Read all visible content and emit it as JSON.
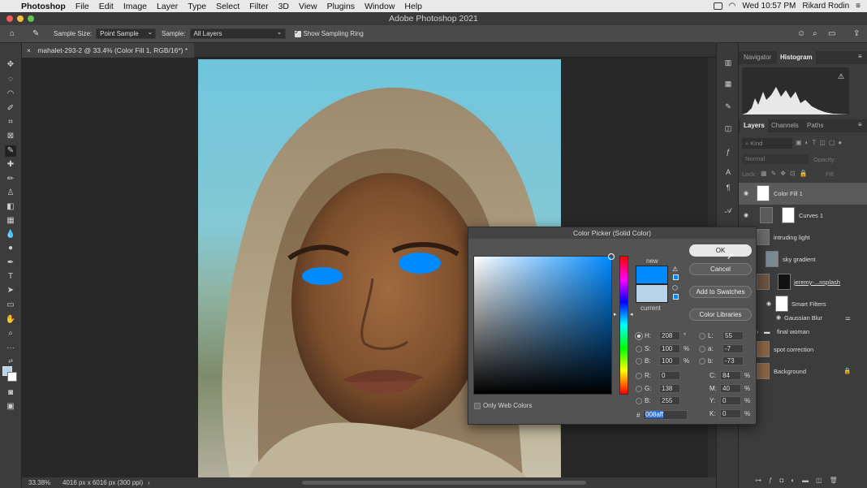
{
  "menubar": {
    "app_name": "Photoshop",
    "items": [
      "File",
      "Edit",
      "Image",
      "Layer",
      "Type",
      "Select",
      "Filter",
      "3D",
      "View",
      "Plugins",
      "Window",
      "Help"
    ],
    "clock": "Wed 10:57 PM",
    "user": "Rikard Rodin"
  },
  "window": {
    "title": "Adobe Photoshop 2021"
  },
  "options_bar": {
    "sample_size_label": "Sample Size:",
    "sample_size_value": "Point Sample",
    "sample_label": "Sample:",
    "sample_value": "All Layers",
    "show_ring_label": "Show Sampling Ring"
  },
  "document": {
    "tab_label": "mahalet-293-2 @ 33.4% (Color Fill 1, RGB/16*) *",
    "zoom": "33.38%",
    "size_info": "4016 px x 6016 px (300 ppi)"
  },
  "panels": {
    "top_tabs": [
      "Navigator",
      "Histogram"
    ],
    "layer_tabs": [
      "Layers",
      "Channels",
      "Paths"
    ],
    "kind_placeholder": "Kind",
    "blend_mode": "Normal",
    "opacity_label": "Opacity:",
    "lock_label": "Lock:",
    "fill_label": "Fill:",
    "layers": [
      {
        "name": "Color Fill 1"
      },
      {
        "name": "Curves 1"
      },
      {
        "name": "intruding light"
      },
      {
        "name": "sky gradient"
      },
      {
        "name": "jeremy-...nsplash"
      },
      {
        "name": "Smart Filters"
      },
      {
        "name": "Gaussian Blur"
      },
      {
        "name": "final woman"
      },
      {
        "name": "spot correction"
      },
      {
        "name": "Background"
      }
    ]
  },
  "color_picker": {
    "title": "Color Picker (Solid Color)",
    "new_label": "new",
    "current_label": "current",
    "new_color": "#008aff",
    "current_color": "#b9d3e9",
    "buttons": {
      "ok": "OK",
      "cancel": "Cancel",
      "add_swatches": "Add to Swatches",
      "color_libraries": "Color Libraries"
    },
    "only_web_colors": "Only Web Colors",
    "hsb": {
      "h": "208",
      "s": "100",
      "b": "100"
    },
    "rgb": {
      "r": "0",
      "g": "138",
      "b": "255"
    },
    "lab": {
      "l": "55",
      "a": "-7",
      "b": "-73"
    },
    "cmyk": {
      "c": "84",
      "m": "40",
      "y": "0",
      "k": "0"
    },
    "hex_label": "#",
    "hex": "008aff",
    "units": {
      "degree": "°",
      "percent": "%"
    },
    "labels": {
      "h": "H:",
      "s": "S:",
      "b": "B:",
      "r": "R:",
      "g": "G:",
      "bb": "B:",
      "l": "L:",
      "a": "a:",
      "lb": "b:",
      "c": "C:",
      "m": "M:",
      "y": "Y:",
      "k": "K:"
    }
  },
  "colors": {
    "accent": "#008aff",
    "panel_bg": "#3c3c3c",
    "dialog_bg": "#535353"
  }
}
